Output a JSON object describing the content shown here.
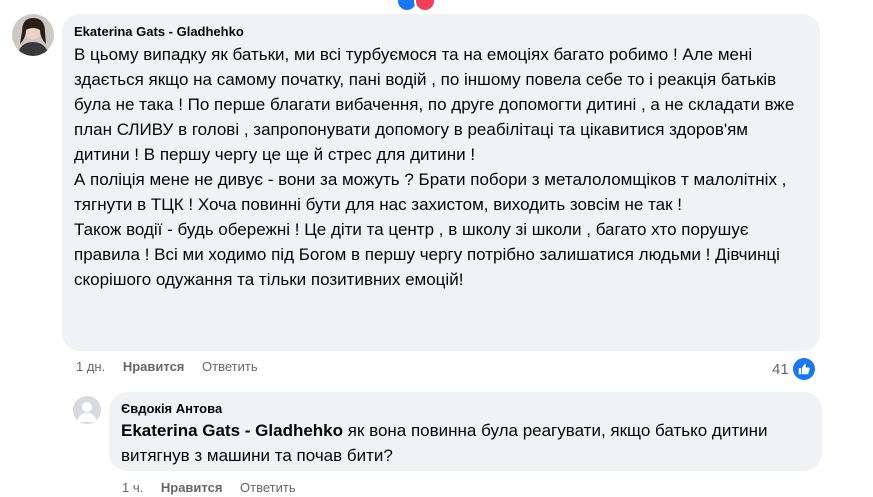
{
  "comment1": {
    "author": "Ekaterina Gats - Gladhehko",
    "paragraphs": [
      "В цьому випадку як батьки, ми всі турбуємося та на емоціях багато робимо ! Але мені здається якщо на самому початку, пані водій , по іншому повела себе то і реакція батьків була не така ! По перше благати вибачення, по друге допомогти дитині , а не складати вже план СЛИВУ в голові , запропонувати допомогу в реабілітаці та цікавитися здоров'ям дитини ! В першу чергу це ще й стрес для дитини !",
      "А поліція мене не дивує - вони за можуть ? Брати побори з металоломщіков т малолітніх , тягнути в ТЦК ! Хоча повинні бути для нас захистом, виходить зовсім не так !",
      "Також водії - будь обережні ! Це діти та центр , в школу зі школи , багато хто порушує правила ! Всі ми ходимо під Богом в першу чергу потрібно залишатися людьми ! Дівчинці скорішого одужання та тільки позитивних емоцій!"
    ],
    "time": "1 дн.",
    "like_label": "Нравится",
    "reply_label": "Ответить",
    "reaction_count": "41"
  },
  "comment2": {
    "author": "Євдокія Антова",
    "tag": "Ekaterina Gats - Gladhehko",
    "text": " як вона повинна була реагувати, якщо батько дитини витягнув з машини та почав бити?",
    "time": "1 ч.",
    "like_label": "Нравится",
    "reply_label": "Ответить"
  },
  "colors": {
    "bubble": "#f0f2f5",
    "meta_text": "#65676b",
    "like_blue": "#1877f2"
  },
  "icons": [
    "avatar",
    "like-icon",
    "reaction-icons"
  ]
}
